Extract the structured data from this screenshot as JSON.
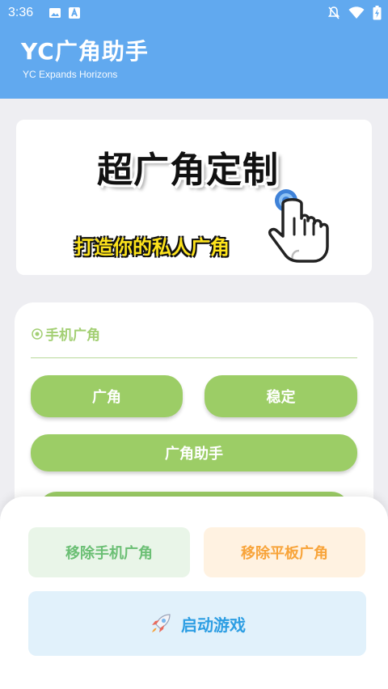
{
  "status_bar": {
    "time": "3:36",
    "left_icons": [
      "image-icon",
      "app-a-icon"
    ],
    "right_icons": [
      "mute-icon",
      "wifi-icon",
      "battery-icon"
    ]
  },
  "app_bar": {
    "title": "YC广角助手",
    "subtitle": "YC Expands Horizons",
    "color": "#61a9ef"
  },
  "banner": {
    "headline": "超广角定制",
    "tagline": "打造你的私人广角",
    "icon": "tap-hand-icon"
  },
  "phone_section": {
    "label": "手机广角",
    "icon": "radio-circle-icon",
    "buttons": {
      "wide": "广角",
      "stable": "稳定",
      "assistant": "广角助手"
    },
    "accent": "#9ccd66"
  },
  "bottom_sheet": {
    "remove_phone": "移除手机广角",
    "remove_tablet": "移除平板广角",
    "launch_game": "启动游戏",
    "launch_icon": "rocket-icon"
  }
}
